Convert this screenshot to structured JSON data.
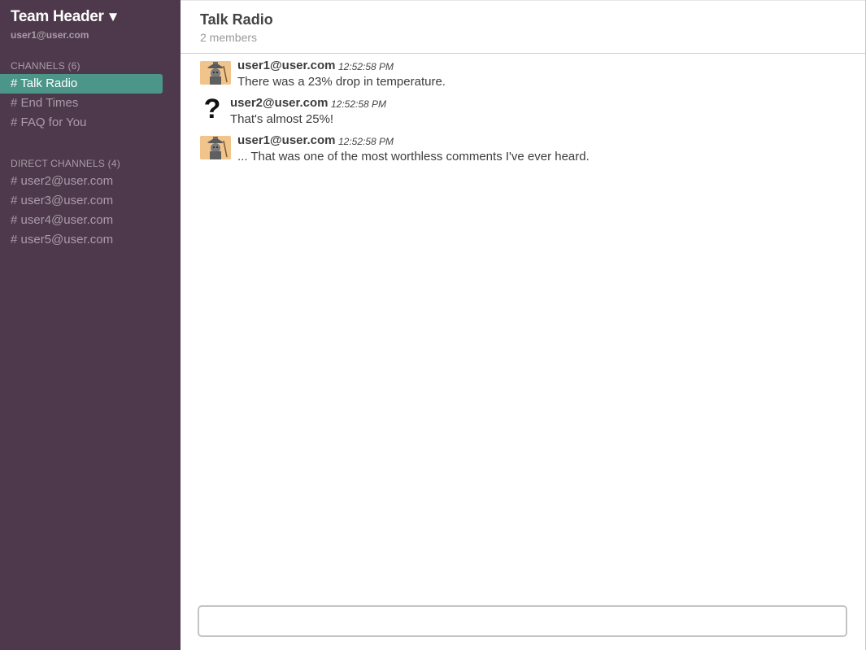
{
  "sidebar": {
    "team_name": "Team Header",
    "caret": "▼",
    "current_user": "user1@user.com",
    "channels_label": "CHANNELS (6)",
    "channels": [
      {
        "label": "# Talk Radio",
        "active": true
      },
      {
        "label": "# End Times",
        "active": false
      },
      {
        "label": "# FAQ for You",
        "active": false
      }
    ],
    "direct_label": "DIRECT CHANNELS (4)",
    "direct": [
      {
        "label": "# user2@user.com"
      },
      {
        "label": "# user3@user.com"
      },
      {
        "label": "# user4@user.com"
      },
      {
        "label": "# user5@user.com"
      }
    ]
  },
  "channel": {
    "title": "Talk Radio",
    "members": "2 members"
  },
  "messages": [
    {
      "user": "user1@user.com",
      "time": "12:52:58 PM",
      "text": "There was a 23% drop in temperature.",
      "avatar": "user-photo-icon"
    },
    {
      "user": "user2@user.com",
      "time": "12:52:58 PM",
      "text": "That's almost 25%!",
      "avatar": "question-mark-icon"
    },
    {
      "user": "user1@user.com",
      "time": "12:52:58 PM",
      "text": "... That was one of the most worthless comments I've ever heard.",
      "avatar": "user-photo-icon"
    }
  ],
  "composer": {
    "placeholder": "",
    "value": ""
  },
  "colors": {
    "sidebar_bg": "#4d394b",
    "sidebar_text": "#ab9ba9",
    "active_channel": "#4c9689",
    "avatar_bg": "#f1c48c"
  }
}
